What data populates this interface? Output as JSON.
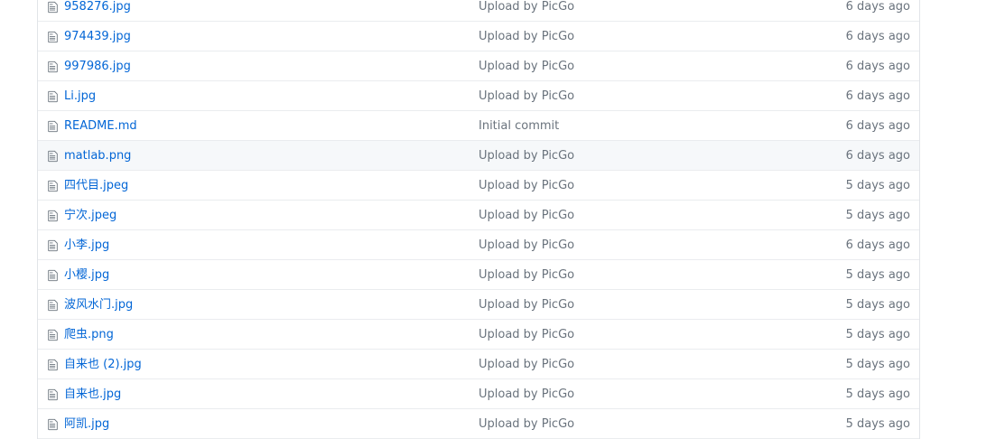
{
  "file_list": {
    "rows": [
      {
        "name": "958276.jpg",
        "message": "Upload by PicGo",
        "age": "6 days ago"
      },
      {
        "name": "974439.jpg",
        "message": "Upload by PicGo",
        "age": "6 days ago"
      },
      {
        "name": "997986.jpg",
        "message": "Upload by PicGo",
        "age": "6 days ago"
      },
      {
        "name": "Li.jpg",
        "message": "Upload by PicGo",
        "age": "6 days ago"
      },
      {
        "name": "README.md",
        "message": "Initial commit",
        "age": "6 days ago"
      },
      {
        "name": "matlab.png",
        "message": "Upload by PicGo",
        "age": "6 days ago",
        "hovered": true
      },
      {
        "name": "四代目.jpeg",
        "message": "Upload by PicGo",
        "age": "5 days ago"
      },
      {
        "name": "宁次.jpeg",
        "message": "Upload by PicGo",
        "age": "5 days ago"
      },
      {
        "name": "小李.jpg",
        "message": "Upload by PicGo",
        "age": "6 days ago"
      },
      {
        "name": "小樱.jpg",
        "message": "Upload by PicGo",
        "age": "5 days ago"
      },
      {
        "name": "波风水门.jpg",
        "message": "Upload by PicGo",
        "age": "5 days ago"
      },
      {
        "name": "爬虫.png",
        "message": "Upload by PicGo",
        "age": "5 days ago"
      },
      {
        "name": "自来也 (2).jpg",
        "message": "Upload by PicGo",
        "age": "5 days ago"
      },
      {
        "name": "自来也.jpg",
        "message": "Upload by PicGo",
        "age": "5 days ago"
      },
      {
        "name": "阿凯.jpg",
        "message": "Upload by PicGo",
        "age": "5 days ago"
      }
    ]
  },
  "icons": {
    "file": "file-icon"
  },
  "colors": {
    "link": "#0366d6",
    "muted": "#6a737d",
    "border": "#eaecef",
    "hover_row": "#f6f8fa",
    "icon": "#6a737d"
  }
}
